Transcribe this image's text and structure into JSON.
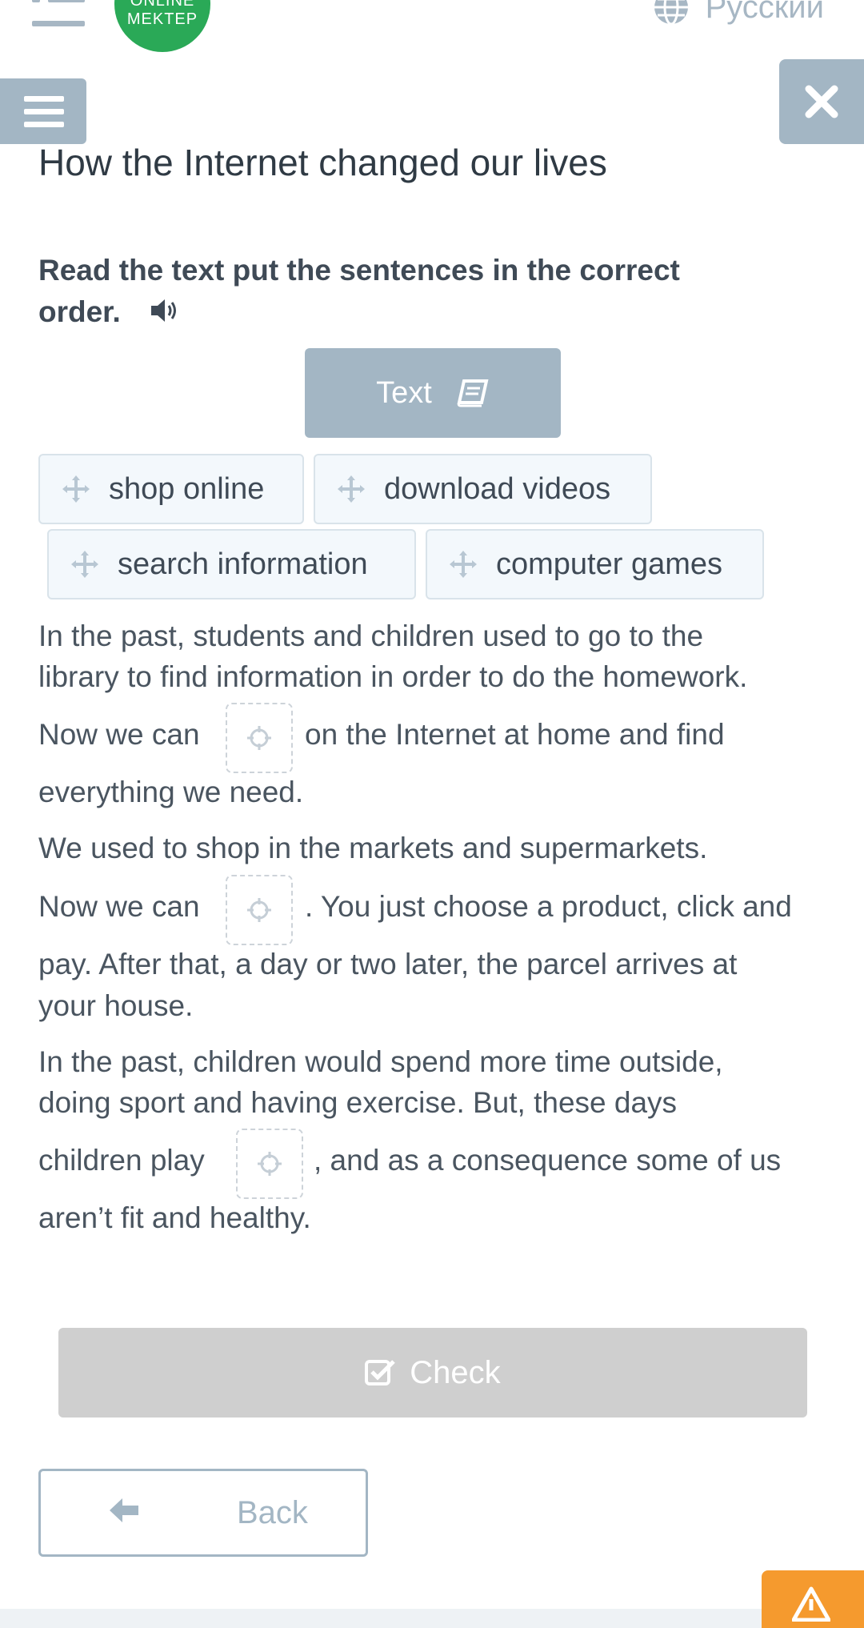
{
  "header": {
    "logo_line1": "ONLINE",
    "logo_line2": "MEKTEP",
    "language": "Русский"
  },
  "page": {
    "title": "How the Internet changed our lives",
    "instruction": "Read the text put the sentences in the correct order.",
    "text_button": "Text"
  },
  "options": [
    {
      "label": "shop online"
    },
    {
      "label": "download videos"
    },
    {
      "label": "search information"
    },
    {
      "label": "computer games"
    }
  ],
  "exercise": {
    "p1_l1": "In the past, students and children used to go to the",
    "p1_l2": "library to find information in order to do the homework.",
    "p1_l3a": "Now we can",
    "p1_l3b": "on the Internet at home and find",
    "p1_l4": "everything we need.",
    "p2_l1": "We used to shop in the markets and supermarkets.",
    "p2_l2a": "Now we can",
    "p2_l2b": ". You just choose a product, click and",
    "p2_l3": "pay. After that, a day or two later, the parcel arrives at",
    "p2_l4": "your house.",
    "p3_l1": "In the past, children would spend more time outside,",
    "p3_l2": "doing sport and having exercise. But, these days",
    "p3_l3a": "children play",
    "p3_l3b": ", and as a consequence some of us",
    "p3_l4": "aren’t fit and healthy."
  },
  "actions": {
    "check": "Check",
    "back": "Back"
  },
  "colors": {
    "accent": "#a3b6c4",
    "brand_green": "#2aa957",
    "check_disabled": "#cfcfcf",
    "warning": "#f59a2e"
  }
}
